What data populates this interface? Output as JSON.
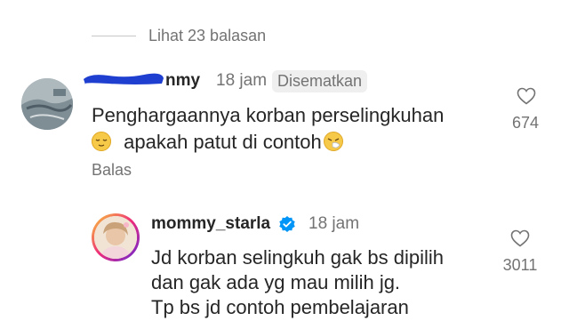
{
  "thread": {
    "view_replies_label": "Lihat 23 balasan"
  },
  "comment1": {
    "username_visible": "nmy",
    "time": "18 jam",
    "pinned_label": "Disematkan",
    "line1": "Penghargaannya korban perselingkuhan",
    "line2": "apakah patut di contoh",
    "emoji_start": "relieved-face",
    "emoji_end": "sneezing-face",
    "reply_label": "Balas",
    "likes": "674"
  },
  "comment2": {
    "username": "mommy_starla",
    "verified": true,
    "time": "18 jam",
    "line1": "Jd korban selingkuh gak bs dipilih",
    "line2": "dan gak ada yg mau milih jg.",
    "line3": "Tp bs jd contoh pembelajaran",
    "likes": "3011"
  },
  "colors": {
    "text": "#262626",
    "muted": "#737373",
    "verified": "#0095f6",
    "redaction": "#1f3fd0"
  }
}
